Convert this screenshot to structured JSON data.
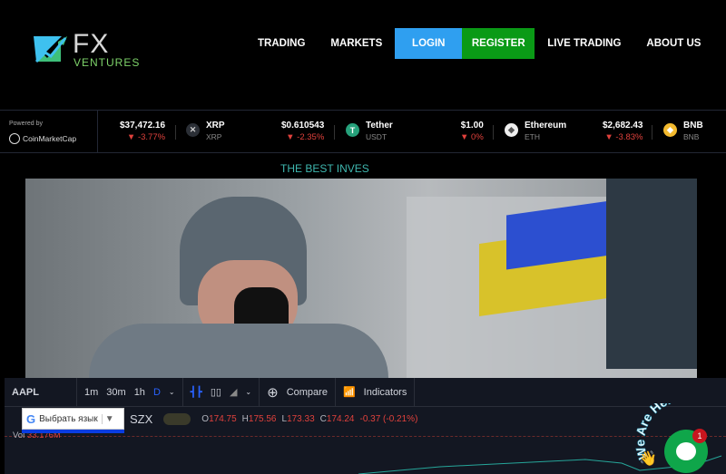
{
  "logo": {
    "title": "FX",
    "subtitle": "VENTURES"
  },
  "nav": [
    "TRADING",
    "MARKETS",
    "LOGIN",
    "REGISTER",
    "LIVE TRADING",
    "ABOUT US"
  ],
  "ticker": {
    "powered_by": "Powered by",
    "provider": "CoinMarketCap",
    "first_price": "$37,472.16",
    "first_change": "-3.77%",
    "coins": [
      {
        "name": "XRP",
        "symbol": "XRP",
        "price": "$0.610543",
        "change": "-2.35%",
        "color": "#2b2f36"
      },
      {
        "name": "Tether",
        "symbol": "USDT",
        "price": "$1.00",
        "change": "0%",
        "color": "#26a17b"
      },
      {
        "name": "Ethereum",
        "symbol": "ETH",
        "price": "$2,682.43",
        "change": "-3.83%",
        "color": "#eeeeee"
      },
      {
        "name": "BNB",
        "symbol": "BNB",
        "color": "#f3ba2f"
      }
    ]
  },
  "tagline": "THE BEST INVES",
  "chart_widget": {
    "symbol": "AAPL",
    "intervals": [
      "1m",
      "30m",
      "1h",
      "D"
    ],
    "active_interval": "D",
    "compare": "Compare",
    "indicators": "Indicators",
    "exchange_suffix": "SZX",
    "ohlc": {
      "o_label": "O",
      "o": "174.75",
      "h_label": "H",
      "h": "175.56",
      "l_label": "L",
      "l": "173.33",
      "c_label": "C",
      "c": "174.24",
      "change": "-0.37 (-0.21%)"
    },
    "vol_label": "Vol",
    "vol": "33.176M"
  },
  "translate": {
    "label": "Выбрать язык"
  },
  "chat": {
    "banner": "We Are Here!",
    "badge": "1"
  }
}
